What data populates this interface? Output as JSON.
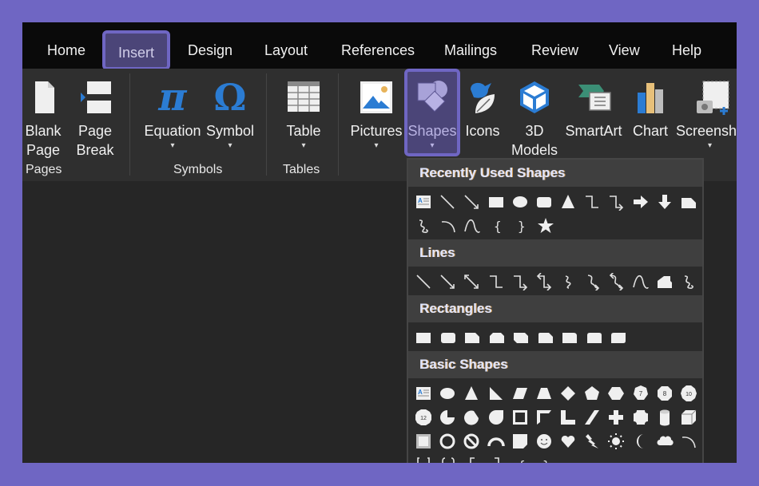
{
  "tabs": [
    {
      "label": "Home",
      "active": false
    },
    {
      "label": "Insert",
      "active": true
    },
    {
      "label": "Design",
      "active": false
    },
    {
      "label": "Layout",
      "active": false
    },
    {
      "label": "References",
      "active": false
    },
    {
      "label": "Mailings",
      "active": false
    },
    {
      "label": "Review",
      "active": false
    },
    {
      "label": "View",
      "active": false
    },
    {
      "label": "Help",
      "active": false
    }
  ],
  "ribbon": {
    "groups": {
      "pages": "Pages",
      "symbols": "Symbols",
      "tables": "Tables"
    },
    "buttons": {
      "blank_page": {
        "line1": "Blank",
        "line2": "Page",
        "icon": "blank-page-icon"
      },
      "page_break": {
        "line1": "Page",
        "line2": "Break",
        "icon": "page-break-icon"
      },
      "equation": {
        "label": "Equation",
        "icon": "pi-icon",
        "glyph": "π"
      },
      "symbol": {
        "label": "Symbol",
        "icon": "omega-icon",
        "glyph": "Ω"
      },
      "table": {
        "label": "Table",
        "icon": "table-icon"
      },
      "pictures": {
        "label": "Pictures",
        "icon": "picture-icon"
      },
      "shapes": {
        "label": "Shapes",
        "icon": "shapes-icon"
      },
      "icons": {
        "label": "Icons",
        "icon": "icons-icon"
      },
      "models3d": {
        "line1": "3D",
        "line2": "Models",
        "icon": "cube-icon"
      },
      "smartart": {
        "label": "SmartArt",
        "icon": "smartart-icon"
      },
      "chart": {
        "label": "Chart",
        "icon": "chart-icon"
      },
      "screenshot": {
        "label": "Screensh",
        "icon": "screenshot-icon"
      }
    },
    "caret": "▾"
  },
  "shapes_menu": {
    "sections": [
      {
        "title": "Recently Used Shapes",
        "rows": [
          [
            "text-box",
            "line",
            "arrow-line",
            "rectangle",
            "oval",
            "rounded-rectangle",
            "isosceles-triangle",
            "elbow-connector",
            "elbow-arrow-connector",
            "right-arrow",
            "down-arrow",
            "snip-rectangle"
          ],
          [
            "scribble",
            "arc",
            "curve",
            "left-brace",
            "right-brace",
            "star-5-point"
          ]
        ]
      },
      {
        "title": "Lines",
        "rows": [
          [
            "line",
            "arrow-line",
            "double-arrow-line",
            "elbow-connector",
            "elbow-arrow-connector",
            "elbow-double-arrow",
            "curved-connector",
            "curved-arrow-connector",
            "curved-double-arrow",
            "curve",
            "freeform",
            "scribble"
          ]
        ]
      },
      {
        "title": "Rectangles",
        "rows": [
          [
            "rectangle",
            "rounded-rectangle",
            "snip-single-corner",
            "snip-same-side",
            "snip-diagonal",
            "snip-round-single",
            "round-single-corner",
            "round-same-side",
            "round-diagonal"
          ]
        ]
      },
      {
        "title": "Basic Shapes",
        "rows": [
          [
            "text-box",
            "oval",
            "isosceles-triangle",
            "right-triangle",
            "parallelogram",
            "trapezoid",
            "diamond",
            "pentagon",
            "hexagon",
            "heptagon",
            "octagon",
            "decagon"
          ],
          [
            "dodecagon",
            "pie",
            "chord",
            "teardrop",
            "frame",
            "half-frame",
            "l-shape",
            "diagonal-stripe",
            "cross",
            "plaque",
            "can",
            "cube"
          ],
          [
            "bevel",
            "donut",
            "no-symbol",
            "block-arc",
            "folded-corner",
            "smiley-face",
            "heart",
            "lightning-bolt",
            "sun",
            "moon",
            "cloud",
            "arc"
          ],
          [
            "double-bracket",
            "double-brace",
            "left-bracket",
            "right-bracket",
            "left-brace",
            "right-brace"
          ]
        ]
      }
    ],
    "labels": {
      "heptagon": "7",
      "octagon": "8",
      "decagon": "10",
      "dodecagon": "12"
    }
  },
  "colors": {
    "frame": "#6f66c3",
    "accent_blue": "#2b7cd3",
    "active_tab_bg": "#4b4578"
  }
}
